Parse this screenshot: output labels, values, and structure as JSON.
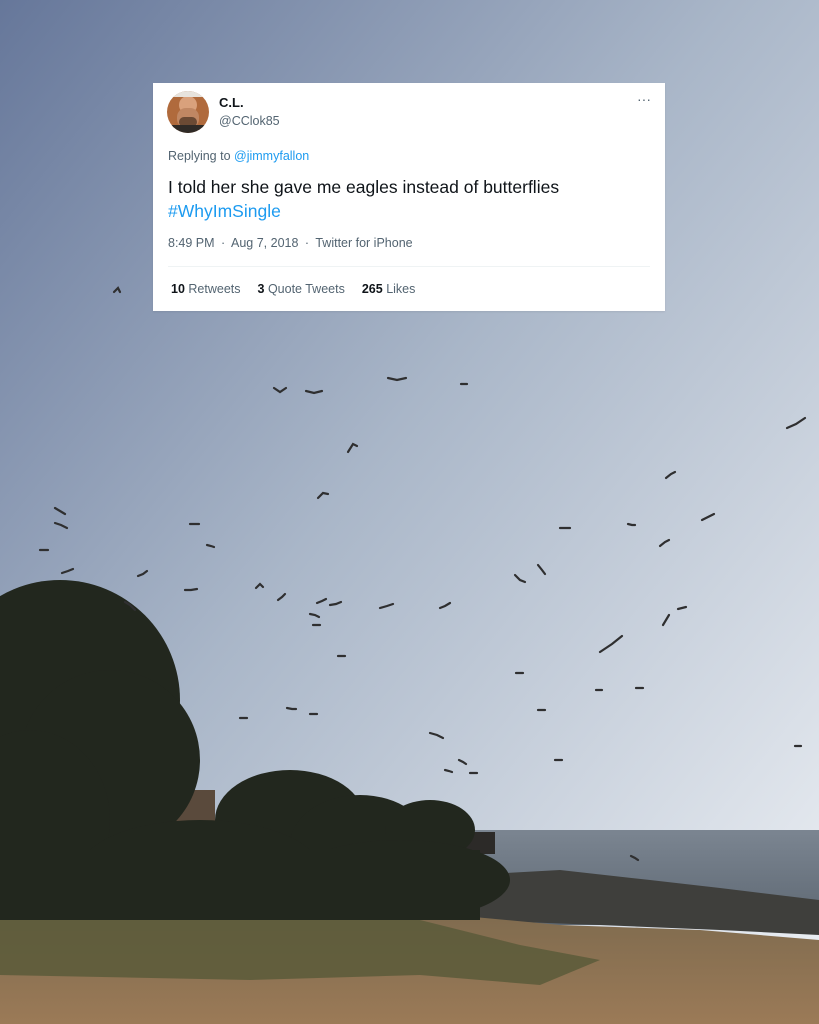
{
  "tweet": {
    "display_name": "C.L.",
    "handle": "@CClok85",
    "more_label": "···",
    "reply_prefix": "Replying to",
    "reply_mention": "@jimmyfallon",
    "text": "I told her she gave me eagles instead of butterflies",
    "hashtag": "#WhyImSingle",
    "time": "8:49 PM",
    "date": "Aug 7, 2018",
    "separator": "·",
    "source": "Twitter for iPhone",
    "stats": {
      "retweets_count": "10",
      "retweets_label": "Retweets",
      "quotes_count": "3",
      "quotes_label": "Quote Tweets",
      "likes_count": "265",
      "likes_label": "Likes"
    }
  },
  "colors": {
    "link": "#1d9bf0",
    "text_primary": "#0f1419",
    "text_secondary": "#536471",
    "sky_top": "#6e7e98",
    "sky_bottom": "#e4e8ef",
    "sea": "#6d7783",
    "ground": "#8a6d4f"
  },
  "icons": {
    "avatar": "user-avatar-photo",
    "more": "more-options-icon"
  }
}
